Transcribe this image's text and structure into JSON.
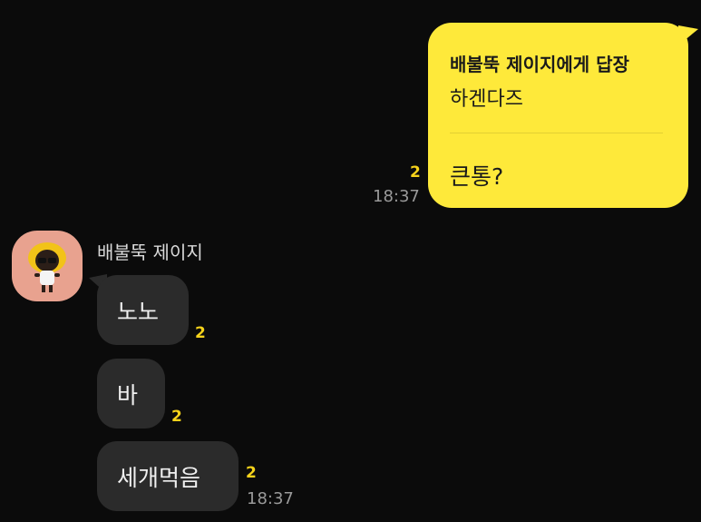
{
  "outgoing": {
    "reply_header": "배불뚝 제이지에게 답장",
    "quoted_text": "하겐다즈",
    "message": "큰통?",
    "unread_count": "2",
    "time": "18:37"
  },
  "incoming": {
    "sender_name": "배불뚝 제이지",
    "messages": [
      {
        "text": "노노",
        "unread_count": "2"
      },
      {
        "text": "바",
        "unread_count": "2"
      },
      {
        "text": "세개먹음",
        "unread_count": "2"
      }
    ],
    "time": "18:37"
  },
  "colors": {
    "background": "#0b0b0b",
    "outgoing_bubble": "#fee93a",
    "incoming_bubble": "#2b2b2b",
    "unread": "#f5d21b"
  }
}
